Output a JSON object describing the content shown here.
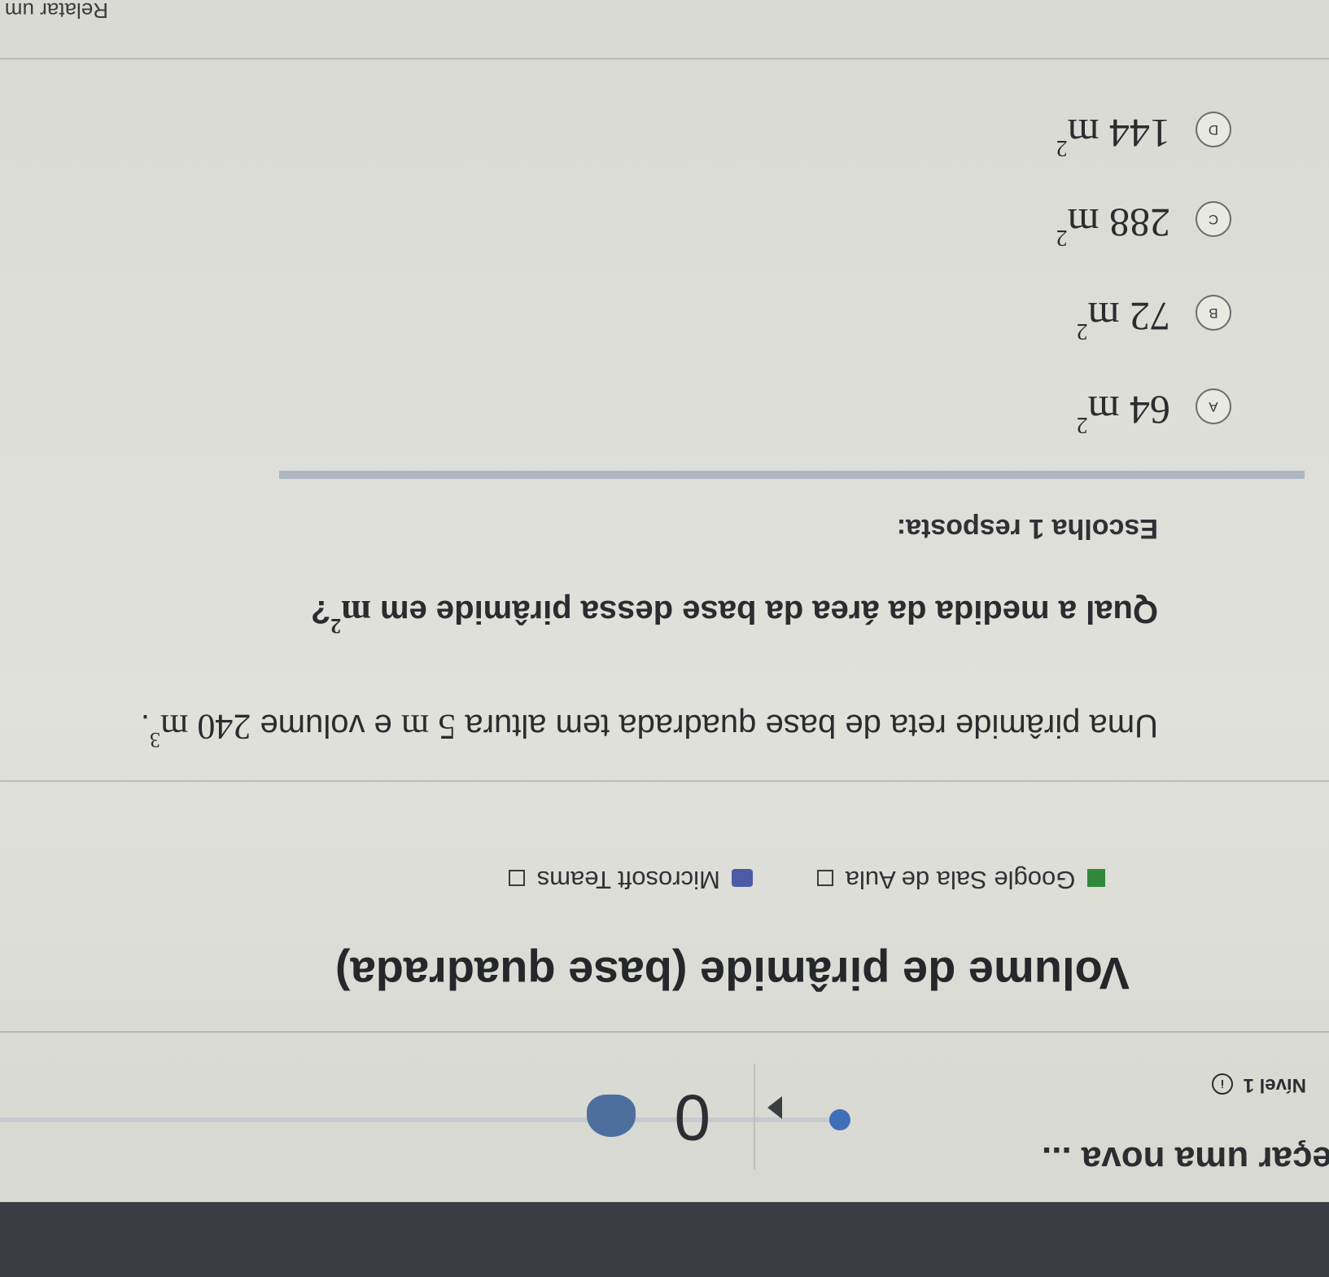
{
  "header": {
    "title_partial": "eçar uma nova ...",
    "level_label": "Nível 1",
    "score": "0"
  },
  "exercise": {
    "title": "Volume de pirâmide (base quadrada)",
    "share_google": "Google Sala de Aula",
    "share_teams": "Microsoft Teams",
    "question_prefix": "Uma pirâmide reta de base quadrada tem altura",
    "height_value": "5",
    "unit_m": "m",
    "question_middle": "e volume",
    "volume_value": "240",
    "volume_exp": "3",
    "question_end": ".",
    "question2_prefix": "Qual a medida da área da base dessa pirâmide em",
    "question2_exp": "2",
    "question2_end": "?",
    "instruction": "Escolha 1 resposta:"
  },
  "options": [
    {
      "letter": "A",
      "value": "64",
      "unit": "m",
      "exp": "2"
    },
    {
      "letter": "B",
      "value": "72",
      "unit": "m",
      "exp": "2"
    },
    {
      "letter": "C",
      "value": "288",
      "unit": "m",
      "exp": "2"
    },
    {
      "letter": "D",
      "value": "144",
      "unit": "m",
      "exp": "2"
    }
  ],
  "footer": {
    "report_link": "Relatar um problema"
  },
  "colors": {
    "accent_blue": "#3f6fb8",
    "background": "#dcddd6",
    "text": "#2a2c30"
  }
}
